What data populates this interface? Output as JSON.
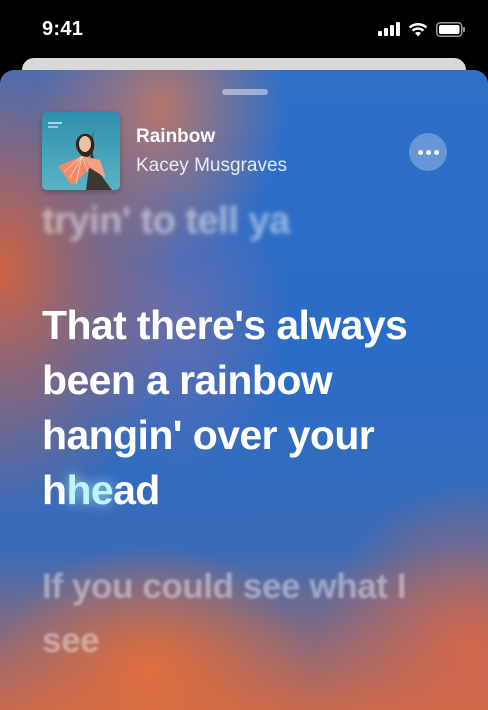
{
  "status_bar": {
    "time": "9:41",
    "icons": [
      "cellular-signal-icon",
      "wifi-icon",
      "battery-icon"
    ]
  },
  "now_playing": {
    "song_title": "Rainbow",
    "artist": "Kacey Musgraves",
    "album_art_icon": "album-cover-icon",
    "more_icon": "ellipsis-icon"
  },
  "lyrics": {
    "previous_line": "tryin' to tell ya",
    "current_line_sung": "That there's always been a rainbow hangin' over your h",
    "current_line_highlight": "he",
    "current_line_rest": "ad",
    "next_line": "If you could see what I see"
  },
  "colors": {
    "lyric_highlight": "#bff6f4",
    "background_blue": "#2a6cc6",
    "background_orange": "#d6623c"
  }
}
